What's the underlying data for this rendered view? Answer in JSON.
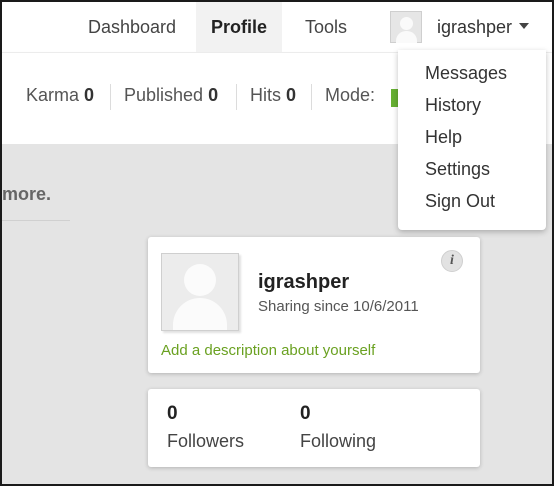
{
  "nav": {
    "items": [
      {
        "label": "Dashboard"
      },
      {
        "label": "Profile",
        "active": true
      },
      {
        "label": "Tools"
      }
    ],
    "username": "igrashper"
  },
  "stats": {
    "karma_label": "Karma",
    "karma_value": "0",
    "published_label": "Published",
    "published_value": "0",
    "hits_label": "Hits",
    "hits_value": "0",
    "mode_label": "Mode:",
    "mode_color": "#66b032"
  },
  "background_text": "more.",
  "profile": {
    "name": "igrashper",
    "since": "Sharing since 10/6/2011",
    "description_link": "Add a description about yourself",
    "info_icon": "i"
  },
  "followers": {
    "count": "0",
    "label": "Followers"
  },
  "following": {
    "count": "0",
    "label": "Following"
  },
  "menu": {
    "items": [
      "Messages",
      "History",
      "Help",
      "Settings",
      "Sign Out"
    ]
  },
  "colors": {
    "accent_green": "#6aa121",
    "mode_green": "#66b032"
  }
}
